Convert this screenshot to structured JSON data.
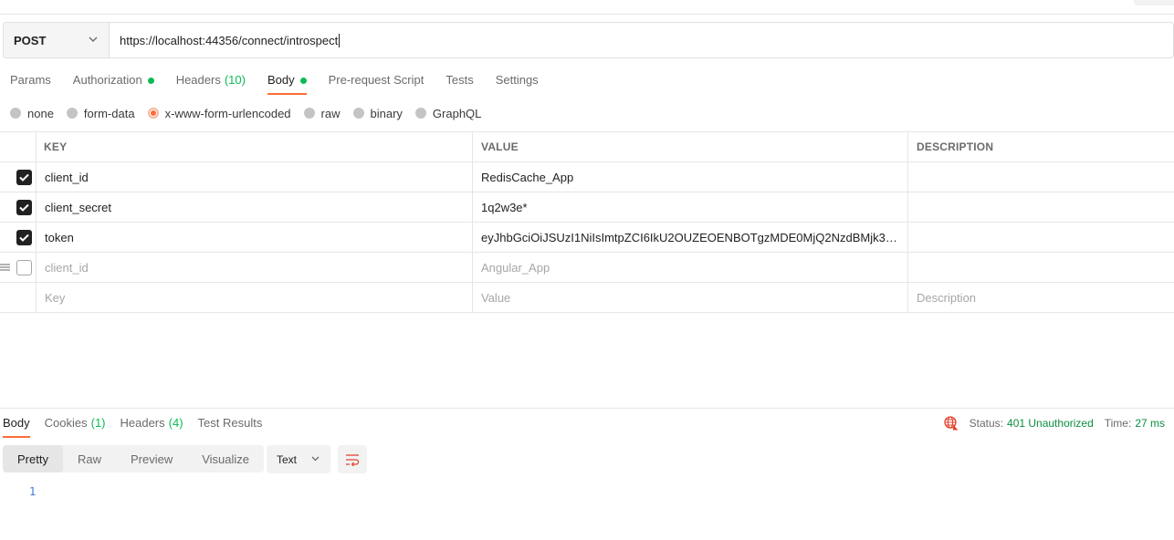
{
  "request": {
    "method": "POST",
    "url": "https://localhost:44356/connect/introspect"
  },
  "request_tabs": [
    {
      "label": "Params"
    },
    {
      "label": "Authorization",
      "dot": true
    },
    {
      "label": "Headers",
      "count": "(10)"
    },
    {
      "label": "Body",
      "dot": true,
      "active": true
    },
    {
      "label": "Pre-request Script"
    },
    {
      "label": "Tests"
    },
    {
      "label": "Settings"
    }
  ],
  "body_types": [
    {
      "label": "none",
      "selected": false
    },
    {
      "label": "form-data",
      "selected": false
    },
    {
      "label": "x-www-form-urlencoded",
      "selected": true
    },
    {
      "label": "raw",
      "selected": false
    },
    {
      "label": "binary",
      "selected": false
    },
    {
      "label": "GraphQL",
      "selected": false
    }
  ],
  "table": {
    "headers": {
      "key": "KEY",
      "value": "VALUE",
      "description": "DESCRIPTION"
    },
    "rows": [
      {
        "checked": true,
        "key": "client_id",
        "value": "RedisCache_App",
        "description": ""
      },
      {
        "checked": true,
        "key": "client_secret",
        "value": "1q2w3e*",
        "description": ""
      },
      {
        "checked": true,
        "key": "token",
        "value": "eyJhbGciOiJSUzI1NiIsImtpZCI6IkU2OUZEOENBOTgzMDE0MjQ2NzdBMjk3MzdG…",
        "description": ""
      },
      {
        "checked": false,
        "key": "client_id",
        "value": "Angular_App",
        "description": ""
      }
    ],
    "new_row": {
      "key_placeholder": "Key",
      "value_placeholder": "Value",
      "description_placeholder": "Description"
    }
  },
  "response": {
    "tabs": [
      {
        "label": "Body",
        "active": true
      },
      {
        "label": "Cookies",
        "count": "(1)"
      },
      {
        "label": "Headers",
        "count": "(4)"
      },
      {
        "label": "Test Results"
      }
    ],
    "status_label": "Status:",
    "status_value": "401 Unauthorized",
    "time_label": "Time:",
    "time_value": "27 ms",
    "view_modes": [
      {
        "label": "Pretty",
        "active": true
      },
      {
        "label": "Raw"
      },
      {
        "label": "Preview"
      },
      {
        "label": "Visualize"
      }
    ],
    "format": "Text",
    "line_number": "1"
  },
  "colors": {
    "accent": "#ff6c37",
    "success": "#0cbb52",
    "status_ok_text": "#0b8f41",
    "error_icon": "#e0452f"
  }
}
